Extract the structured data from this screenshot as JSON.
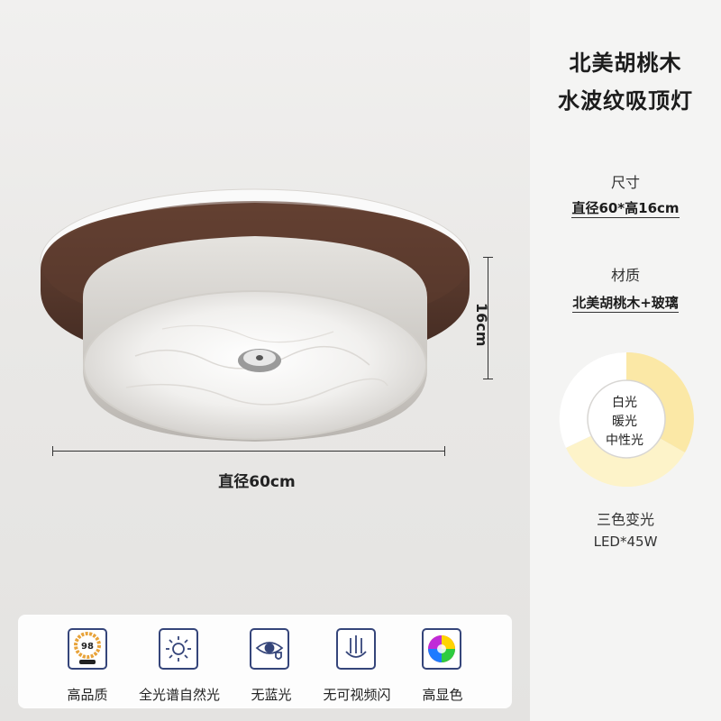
{
  "product": {
    "title_line1": "北美胡桃木",
    "title_line2": "水波纹吸顶灯"
  },
  "size": {
    "label": "尺寸",
    "value": "直径60*高16cm"
  },
  "material": {
    "label": "材质",
    "value": "北美胡桃木+玻璃"
  },
  "dimensions": {
    "width_label": "直径60cm",
    "height_label": "16cm"
  },
  "light_modes": {
    "items": [
      "白光",
      "暖光",
      "中性光"
    ],
    "caption": "三色变光",
    "power": "LED*45W",
    "colors": {
      "white": "#ffffff",
      "warm": "#fbe8a6",
      "neutral": "#fdf3c9"
    }
  },
  "features": [
    {
      "icon": "cri-98-icon",
      "icon_text": "98",
      "label": "高品质"
    },
    {
      "icon": "sun-icon",
      "label": "全光谱自然光"
    },
    {
      "icon": "eye-shield-icon",
      "label": "无蓝光"
    },
    {
      "icon": "no-flicker-icon",
      "label": "无可视频闪"
    },
    {
      "icon": "color-wheel-icon",
      "label": "高显色"
    }
  ],
  "colors": {
    "accent": "#35457a",
    "walnut": "#5a3a2c"
  }
}
